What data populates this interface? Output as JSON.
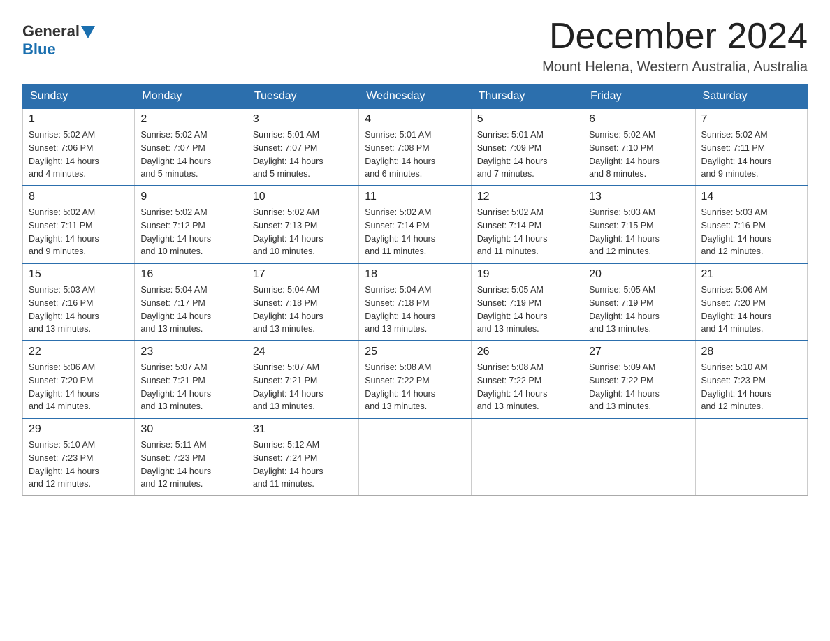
{
  "logo": {
    "general": "General",
    "blue": "Blue"
  },
  "title": "December 2024",
  "location": "Mount Helena, Western Australia, Australia",
  "days_of_week": [
    "Sunday",
    "Monday",
    "Tuesday",
    "Wednesday",
    "Thursday",
    "Friday",
    "Saturday"
  ],
  "weeks": [
    [
      {
        "day": "1",
        "sunrise": "5:02 AM",
        "sunset": "7:06 PM",
        "daylight": "14 hours and 4 minutes."
      },
      {
        "day": "2",
        "sunrise": "5:02 AM",
        "sunset": "7:07 PM",
        "daylight": "14 hours and 5 minutes."
      },
      {
        "day": "3",
        "sunrise": "5:01 AM",
        "sunset": "7:07 PM",
        "daylight": "14 hours and 5 minutes."
      },
      {
        "day": "4",
        "sunrise": "5:01 AM",
        "sunset": "7:08 PM",
        "daylight": "14 hours and 6 minutes."
      },
      {
        "day": "5",
        "sunrise": "5:01 AM",
        "sunset": "7:09 PM",
        "daylight": "14 hours and 7 minutes."
      },
      {
        "day": "6",
        "sunrise": "5:02 AM",
        "sunset": "7:10 PM",
        "daylight": "14 hours and 8 minutes."
      },
      {
        "day": "7",
        "sunrise": "5:02 AM",
        "sunset": "7:11 PM",
        "daylight": "14 hours and 9 minutes."
      }
    ],
    [
      {
        "day": "8",
        "sunrise": "5:02 AM",
        "sunset": "7:11 PM",
        "daylight": "14 hours and 9 minutes."
      },
      {
        "day": "9",
        "sunrise": "5:02 AM",
        "sunset": "7:12 PM",
        "daylight": "14 hours and 10 minutes."
      },
      {
        "day": "10",
        "sunrise": "5:02 AM",
        "sunset": "7:13 PM",
        "daylight": "14 hours and 10 minutes."
      },
      {
        "day": "11",
        "sunrise": "5:02 AM",
        "sunset": "7:14 PM",
        "daylight": "14 hours and 11 minutes."
      },
      {
        "day": "12",
        "sunrise": "5:02 AM",
        "sunset": "7:14 PM",
        "daylight": "14 hours and 11 minutes."
      },
      {
        "day": "13",
        "sunrise": "5:03 AM",
        "sunset": "7:15 PM",
        "daylight": "14 hours and 12 minutes."
      },
      {
        "day": "14",
        "sunrise": "5:03 AM",
        "sunset": "7:16 PM",
        "daylight": "14 hours and 12 minutes."
      }
    ],
    [
      {
        "day": "15",
        "sunrise": "5:03 AM",
        "sunset": "7:16 PM",
        "daylight": "14 hours and 13 minutes."
      },
      {
        "day": "16",
        "sunrise": "5:04 AM",
        "sunset": "7:17 PM",
        "daylight": "14 hours and 13 minutes."
      },
      {
        "day": "17",
        "sunrise": "5:04 AM",
        "sunset": "7:18 PM",
        "daylight": "14 hours and 13 minutes."
      },
      {
        "day": "18",
        "sunrise": "5:04 AM",
        "sunset": "7:18 PM",
        "daylight": "14 hours and 13 minutes."
      },
      {
        "day": "19",
        "sunrise": "5:05 AM",
        "sunset": "7:19 PM",
        "daylight": "14 hours and 13 minutes."
      },
      {
        "day": "20",
        "sunrise": "5:05 AM",
        "sunset": "7:19 PM",
        "daylight": "14 hours and 13 minutes."
      },
      {
        "day": "21",
        "sunrise": "5:06 AM",
        "sunset": "7:20 PM",
        "daylight": "14 hours and 14 minutes."
      }
    ],
    [
      {
        "day": "22",
        "sunrise": "5:06 AM",
        "sunset": "7:20 PM",
        "daylight": "14 hours and 14 minutes."
      },
      {
        "day": "23",
        "sunrise": "5:07 AM",
        "sunset": "7:21 PM",
        "daylight": "14 hours and 13 minutes."
      },
      {
        "day": "24",
        "sunrise": "5:07 AM",
        "sunset": "7:21 PM",
        "daylight": "14 hours and 13 minutes."
      },
      {
        "day": "25",
        "sunrise": "5:08 AM",
        "sunset": "7:22 PM",
        "daylight": "14 hours and 13 minutes."
      },
      {
        "day": "26",
        "sunrise": "5:08 AM",
        "sunset": "7:22 PM",
        "daylight": "14 hours and 13 minutes."
      },
      {
        "day": "27",
        "sunrise": "5:09 AM",
        "sunset": "7:22 PM",
        "daylight": "14 hours and 13 minutes."
      },
      {
        "day": "28",
        "sunrise": "5:10 AM",
        "sunset": "7:23 PM",
        "daylight": "14 hours and 12 minutes."
      }
    ],
    [
      {
        "day": "29",
        "sunrise": "5:10 AM",
        "sunset": "7:23 PM",
        "daylight": "14 hours and 12 minutes."
      },
      {
        "day": "30",
        "sunrise": "5:11 AM",
        "sunset": "7:23 PM",
        "daylight": "14 hours and 12 minutes."
      },
      {
        "day": "31",
        "sunrise": "5:12 AM",
        "sunset": "7:24 PM",
        "daylight": "14 hours and 11 minutes."
      },
      null,
      null,
      null,
      null
    ]
  ],
  "labels": {
    "sunrise": "Sunrise:",
    "sunset": "Sunset:",
    "daylight": "Daylight:"
  }
}
